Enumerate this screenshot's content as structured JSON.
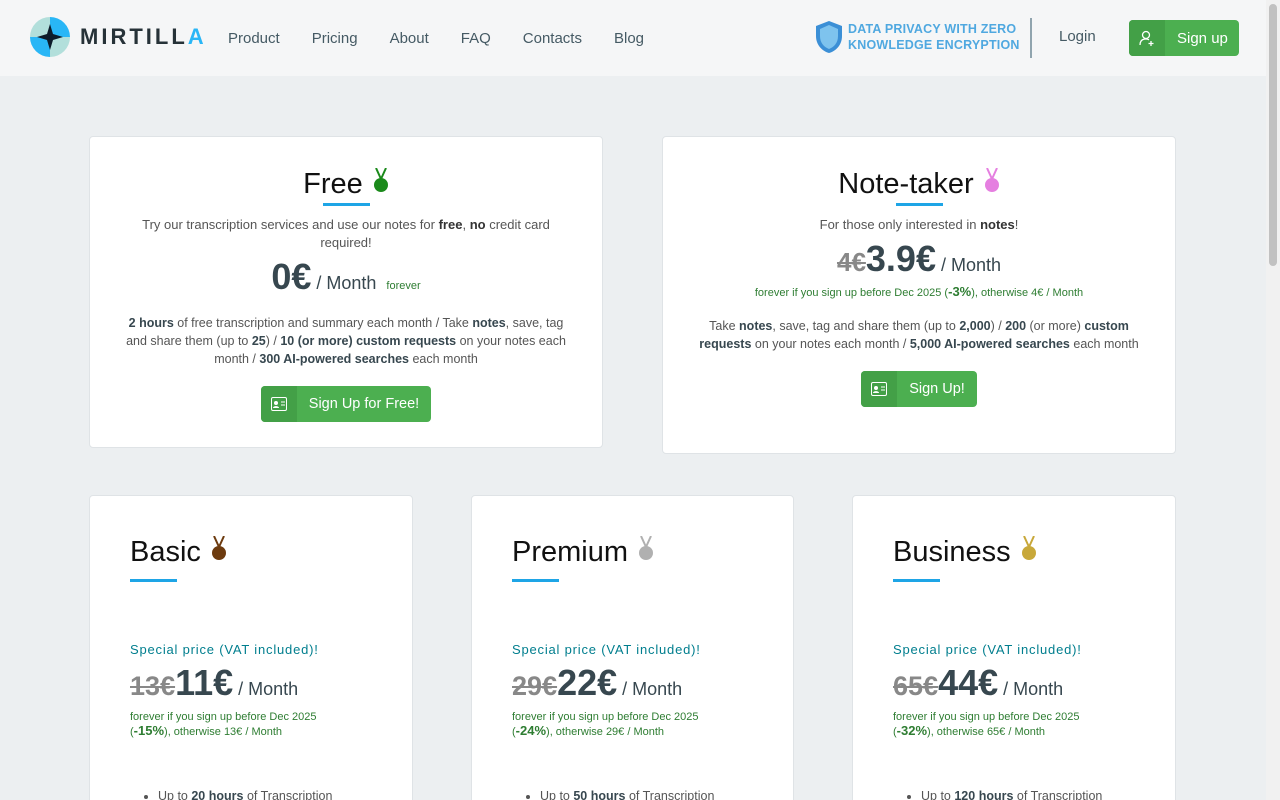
{
  "brand": {
    "name_a": "MIRTILL",
    "name_b": "A"
  },
  "nav": [
    "Product",
    "Pricing",
    "About",
    "FAQ",
    "Contacts",
    "Blog"
  ],
  "privacy": {
    "line1": "DATA PRIVACY WITH ZERO",
    "line2": "KNOWLEDGE ENCRYPTION"
  },
  "header": {
    "login": "Login",
    "signup": "Sign up"
  },
  "free": {
    "title": "Free",
    "desc_a": "Try our transcription services and use our notes for ",
    "desc_b": "free",
    "desc_c": ", ",
    "desc_d": "no",
    "desc_e": " credit card required!",
    "price": "0€",
    "per": " / Month",
    "forever": "forever",
    "f1": "2 hours",
    "f2": " of free transcription and summary each month / Take ",
    "f3": "notes",
    "f4": ", save, tag and share them (up to ",
    "f5": "25",
    "f6": ") / ",
    "f7": "10 (or more) custom requests",
    "f8": " on your notes each month / ",
    "f9": "300 AI-powered searches",
    "f10": " each month",
    "button": "Sign Up for Free!"
  },
  "notetaker": {
    "title": "Note-taker",
    "desc_a": "For those only interested in ",
    "desc_b": "notes",
    "desc_c": "!",
    "old_price": "4€",
    "price": "3.9€",
    "per": " / Month",
    "promo_a": "forever if you sign up before Dec 2025 (",
    "promo_b": "-3%",
    "promo_c": "), otherwise 4€ / Month",
    "f1": "Take ",
    "f2": "notes",
    "f3": ", save, tag and share them (up to ",
    "f4": "2,000",
    "f5": ") / ",
    "f6": "200",
    "f7": " (or more) ",
    "f8": "custom requests",
    "f9": " on your notes each month / ",
    "f10": "5,000 AI-powered searches",
    "f11": " each month",
    "button": "Sign Up!"
  },
  "plans": [
    {
      "title": "Basic",
      "medal_color": "#6d3b0f",
      "special": "Special price (VAT included)!",
      "old_price": "13€",
      "price": "11€",
      "per": " / Month",
      "promo_a": "forever if you sign up before Dec 2025 (",
      "promo_b": "-15%",
      "promo_c": "), otherwise 13€ / Month",
      "feat_a": "Up to ",
      "feat_b": "20 hours",
      "feat_c": " of Transcription"
    },
    {
      "title": "Premium",
      "medal_color": "#b0b0b0",
      "special": "Special price (VAT included)!",
      "old_price": "29€",
      "price": "22€",
      "per": " / Month",
      "promo_a": "forever if you sign up before Dec 2025 (",
      "promo_b": "-24%",
      "promo_c": "), otherwise 29€ / Month",
      "feat_a": "Up to ",
      "feat_b": "50 hours",
      "feat_c": " of Transcription"
    },
    {
      "title": "Business",
      "medal_color": "#c8a83a",
      "special": "Special price (VAT included)!",
      "old_price": "65€",
      "price": "44€",
      "per": " / Month",
      "promo_a": "forever if you sign up before Dec 2025 (",
      "promo_b": "-32%",
      "promo_c": "), otherwise 65€ / Month",
      "feat_a": "Up to ",
      "feat_b": "120 hours",
      "feat_c": " of Transcription"
    }
  ],
  "colors": {
    "accent": "#1ea5e6",
    "green": "#4caf50",
    "promo": "#2e7d32",
    "special": "#007e8e",
    "free_medal": "#1b8a1b",
    "note_medal": "#e57fe0"
  }
}
